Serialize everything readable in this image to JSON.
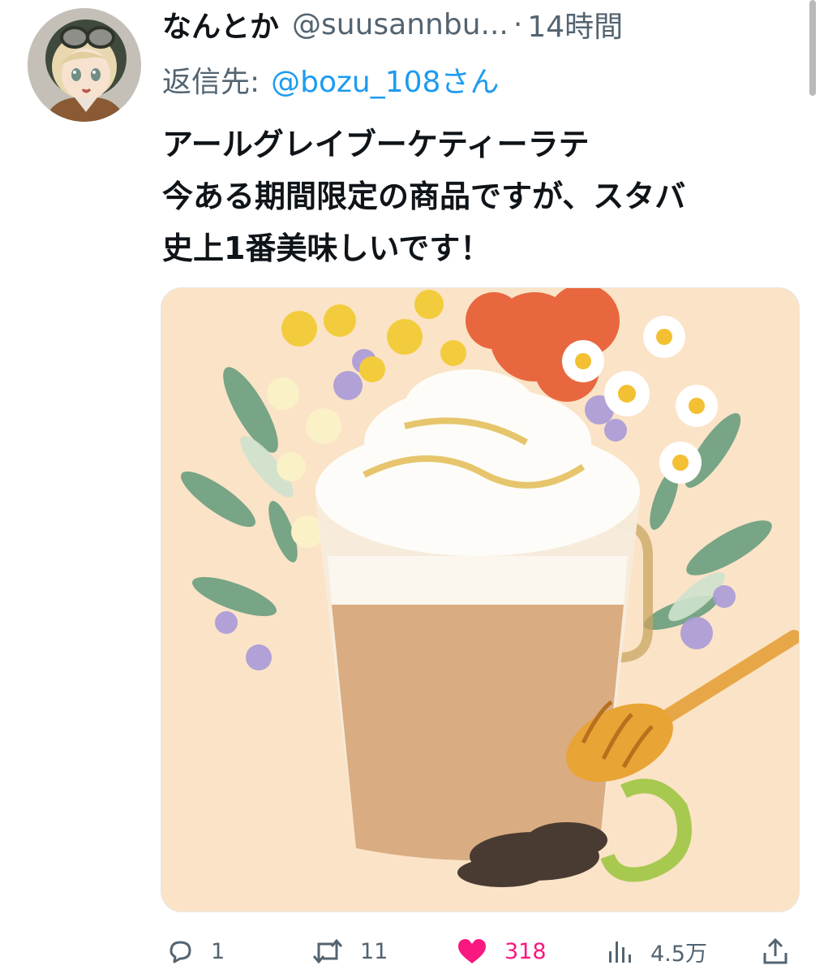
{
  "author": {
    "display_name": "なんとか",
    "handle": "@suusannbu...",
    "separator": "·",
    "time": "14時間"
  },
  "reply": {
    "label": "返信先:",
    "target": "@bozu_108さん"
  },
  "text_lines": [
    "アールグレイブーケティーラテ",
    "今ある期間限定の商品ですが、スタバ",
    "史上1番美味しいです！"
  ],
  "actions": {
    "reply_count": "1",
    "retweet_count": "11",
    "like_count": "318",
    "view_count": "4.5万"
  },
  "colors": {
    "link": "#1d9bf0",
    "muted": "#536471",
    "like": "#f91880"
  },
  "icons": {
    "reply": "speech-bubble-icon",
    "retweet": "retweet-arrows-icon",
    "like": "heart-icon",
    "views": "bar-chart-icon",
    "share": "share-upload-icon"
  }
}
